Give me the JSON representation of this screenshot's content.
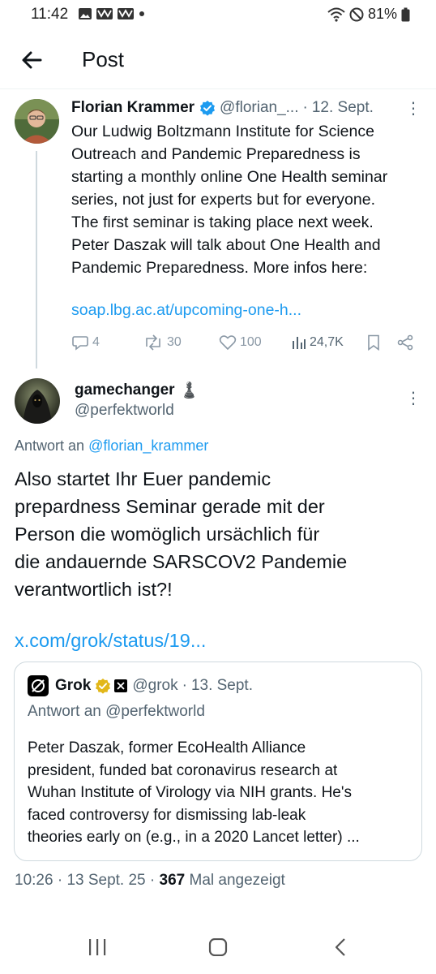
{
  "status": {
    "time": "11:42",
    "battery": "81%"
  },
  "header": {
    "title": "Post"
  },
  "tweet": {
    "name": "Florian Krammer",
    "handle": "@florian_...",
    "separator": "·",
    "date": "12. Sept.",
    "body": "Our Ludwig Boltzmann Institute for Science\nOutreach and Pandemic Preparedness is\nstarting a monthly online One Health seminar\nseries, not just for experts but for everyone.\nThe first seminar is taking place next week.\nPeter Daszak will talk about One Health and\nPandemic Preparedness. More infos here:",
    "link": "soap.lbg.ac.at/upcoming-one-h...",
    "replies": "4",
    "reposts": "30",
    "likes": "100",
    "views": "24,7K"
  },
  "reply": {
    "name": "gamechanger",
    "name_emoji": "♟️",
    "handle": "@perfektworld",
    "reply_prefix": "Antwort an",
    "reply_to": "@florian_krammer",
    "body": "Also startet Ihr Euer pandemic\nprepardness Seminar gerade mit der\nPerson die womöglich ursächlich für\ndie andauernde SARSCOV2 Pandemie\nverantwortlich ist?!",
    "link": "x.com/grok/status/19..."
  },
  "quote": {
    "name": "Grok",
    "handle": "@grok",
    "separator": "·",
    "date": "13. Sept.",
    "reply_line": "Antwort an @perfektworld",
    "body": "Peter Daszak, former EcoHealth Alliance\npresident, funded bat coronavirus research at\nWuhan Institute of Virology via NIH grants. He's\nfaced controversy for dismissing lab-leak\ntheories early on (e.g., in a 2020 Lancet letter) ..."
  },
  "meta": {
    "time": "10:26",
    "sep1": "·",
    "date": "13 Sept. 25",
    "sep2": "·",
    "views": "367",
    "views_label": "Mal angezeigt"
  },
  "colors": {
    "accent": "#1d9bf0",
    "muted": "#536471",
    "text": "#0f1419"
  }
}
